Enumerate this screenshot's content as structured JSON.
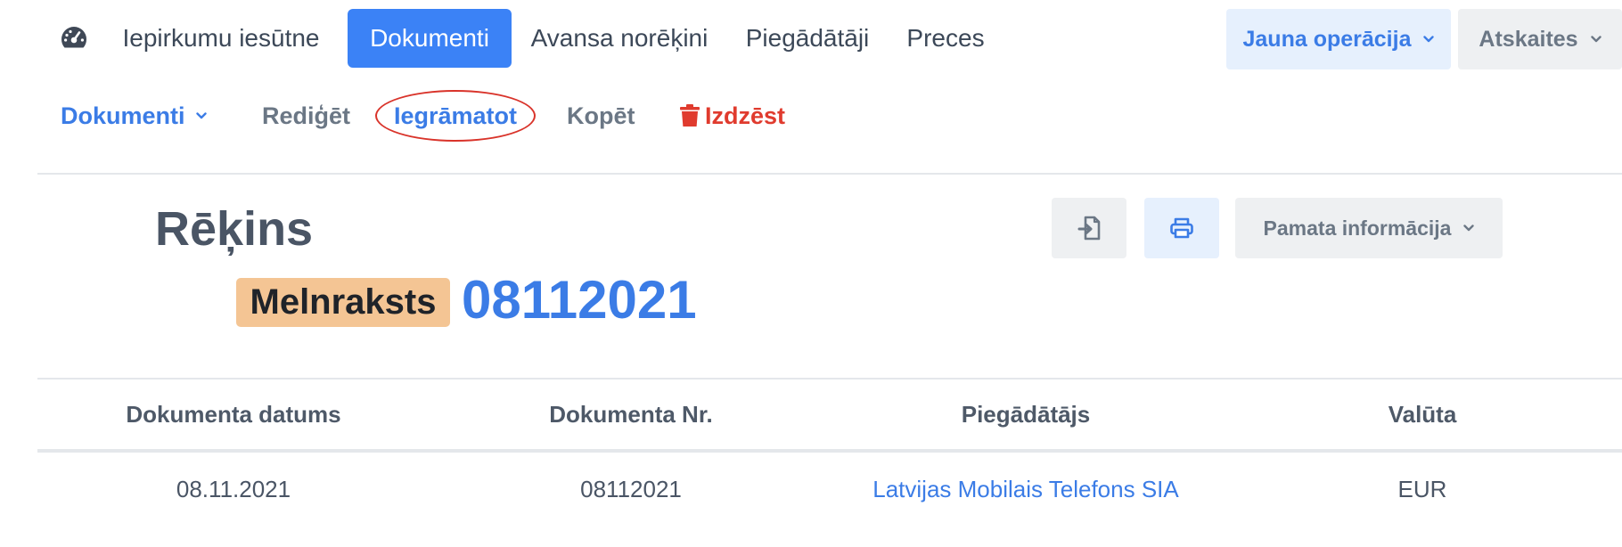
{
  "topnav": {
    "items": [
      {
        "label": "Iepirkumu iesūtne",
        "active": false
      },
      {
        "label": "Dokumenti",
        "active": true
      },
      {
        "label": "Avansa norēķini",
        "active": false
      },
      {
        "label": "Piegādātāji",
        "active": false
      },
      {
        "label": "Preces",
        "active": false
      }
    ],
    "new_operation": "Jauna operācija",
    "reports": "Atskaites",
    "dashboard_icon": "dashboard-gauge-icon"
  },
  "subnav": {
    "documents": "Dokumenti",
    "edit": "Rediģēt",
    "post": "Iegrāmatot",
    "copy": "Kopēt",
    "delete": "Izdzēst"
  },
  "document": {
    "title": "Rēķins",
    "status": "Melnraksts",
    "number": "08112021",
    "basic_info_label": "Pamata informācija",
    "icons": [
      "export-file-icon",
      "print-icon"
    ]
  },
  "table": {
    "headers": [
      "Dokumenta datums",
      "Dokumenta Nr.",
      "Piegādātājs",
      "Valūta"
    ],
    "row": [
      "08.11.2021",
      "08112021",
      "Latvijas Mobilais Telefons SIA",
      "EUR"
    ]
  },
  "colors": {
    "primary": "#3b82f6",
    "danger": "#e03b2e",
    "status_badge": "#f4c594",
    "annotation": "#d9332a"
  }
}
